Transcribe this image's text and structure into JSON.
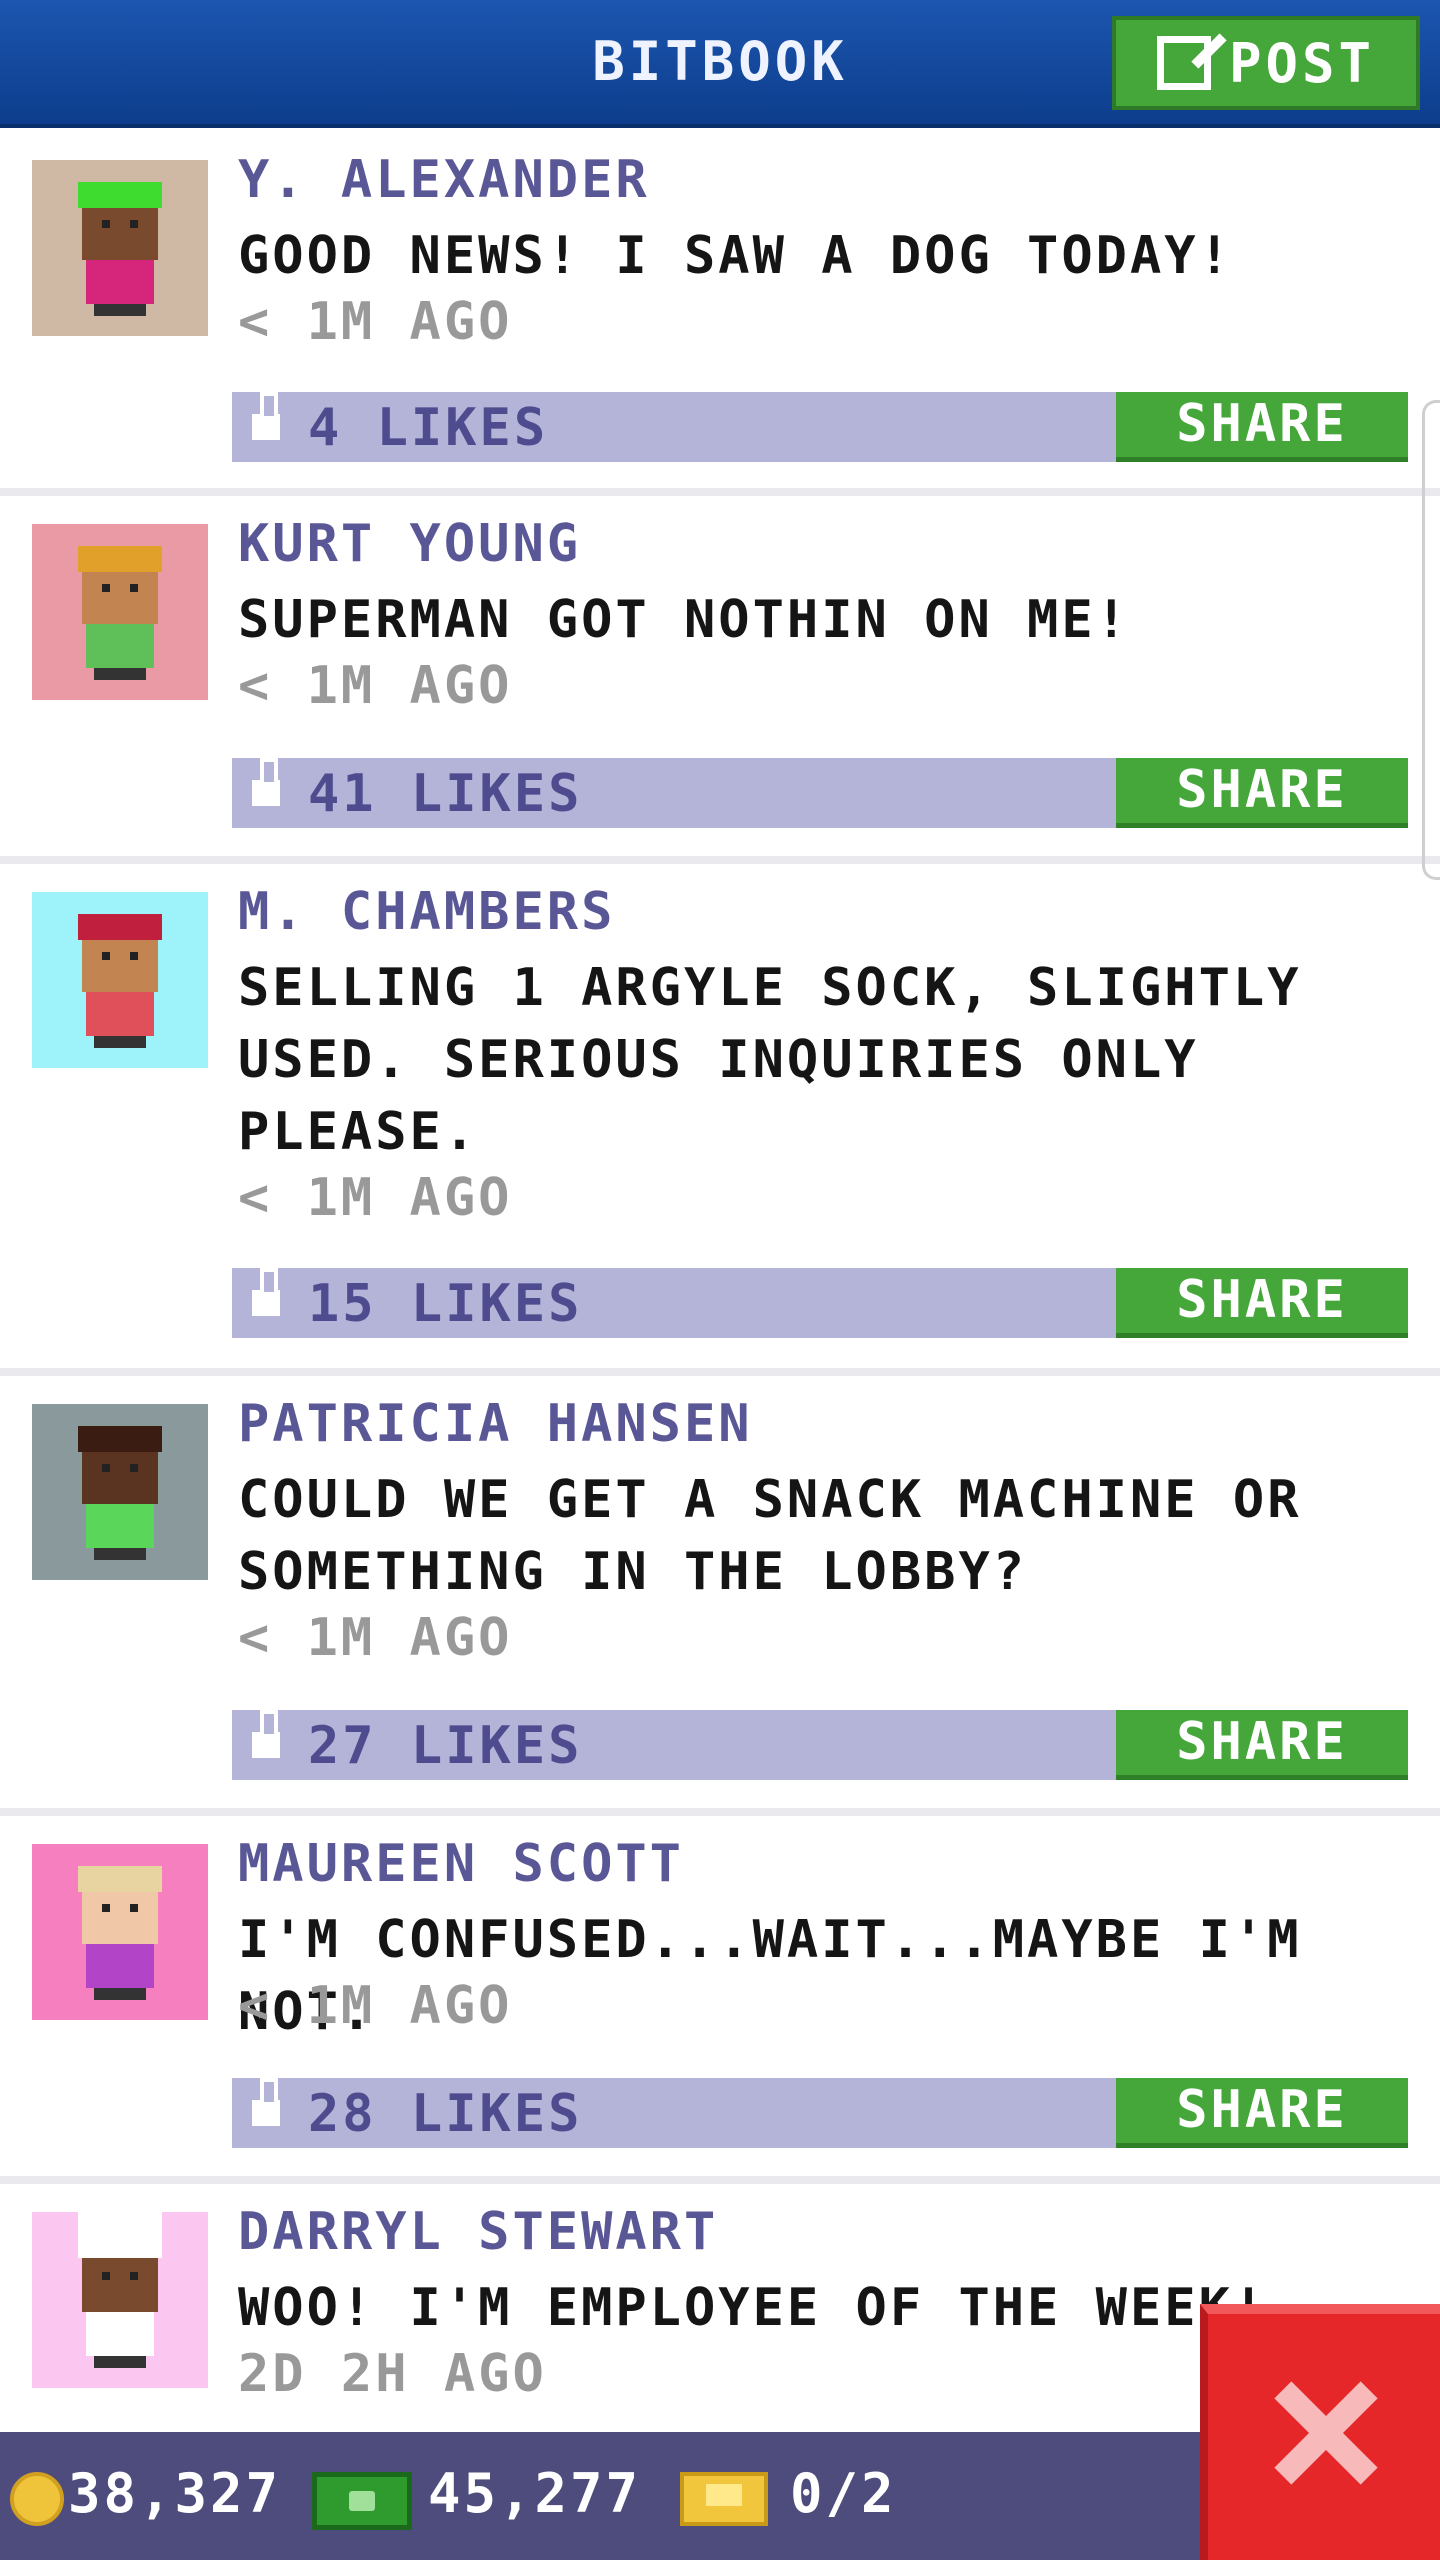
{
  "header": {
    "title": "BITBOOK",
    "post_label": "POST"
  },
  "posts": [
    {
      "name": "Y. ALEXANDER",
      "message": "GOOD NEWS! I SAW A DOG TODAY!",
      "time": "< 1M AGO",
      "likes": "4 LIKES",
      "share": "SHARE",
      "avatar_bg": "#cfb9a4",
      "hair": "#3ddc2e",
      "skin": "#7a4a2e",
      "shirt": "#d6267c"
    },
    {
      "name": "KURT YOUNG",
      "message": "SUPERMAN GOT NOTHIN ON ME!",
      "time": "< 1M AGO",
      "likes": "41 LIKES",
      "share": "SHARE",
      "avatar_bg": "#e99aa4",
      "hair": "#e0a02a",
      "skin": "#c28552",
      "shirt": "#5fc05a"
    },
    {
      "name": "M. CHAMBERS",
      "message": "SELLING 1 ARGYLE SOCK, SLIGHTLY USED. SERIOUS INQUIRIES ONLY PLEASE.",
      "time": "< 1M AGO",
      "likes": "15 LIKES",
      "share": "SHARE",
      "avatar_bg": "#9ef3fa",
      "hair": "#c0203e",
      "skin": "#c28552",
      "shirt": "#e0505a"
    },
    {
      "name": "PATRICIA HANSEN",
      "message": "COULD WE GET A SNACK MACHINE OR SOMETHING IN THE LOBBY?",
      "time": "< 1M AGO",
      "likes": "27 LIKES",
      "share": "SHARE",
      "avatar_bg": "#8a9a9c",
      "hair": "#3a1c12",
      "skin": "#5a3420",
      "shirt": "#5ad75a"
    },
    {
      "name": "MAUREEN SCOTT",
      "message": "I'M CONFUSED...WAIT...MAYBE I'M NOT.",
      "time": "< 1M AGO",
      "likes": "28 LIKES",
      "share": "SHARE",
      "avatar_bg": "#f57fbf",
      "hair": "#e8d4a0",
      "skin": "#f0c8a8",
      "shirt": "#b244c8"
    },
    {
      "name": "DARRYL STEWART",
      "message": "WOO! I'M EMPLOYEE OF THE WEEK!",
      "time": "2D 2H AGO",
      "likes": "",
      "share": "",
      "avatar_bg": "#fbc6f0",
      "hair": "#ffffff",
      "skin": "#7a4a2e",
      "shirt": "#ffffff"
    }
  ],
  "stats": {
    "coins": "38,327",
    "cash": "45,277",
    "tickets": "0/2"
  },
  "colors": {
    "header": "#1c56b0",
    "share": "#45a63a",
    "likes_bar": "#b4b4d8",
    "name": "#5a5796",
    "close": "#e6272a"
  }
}
